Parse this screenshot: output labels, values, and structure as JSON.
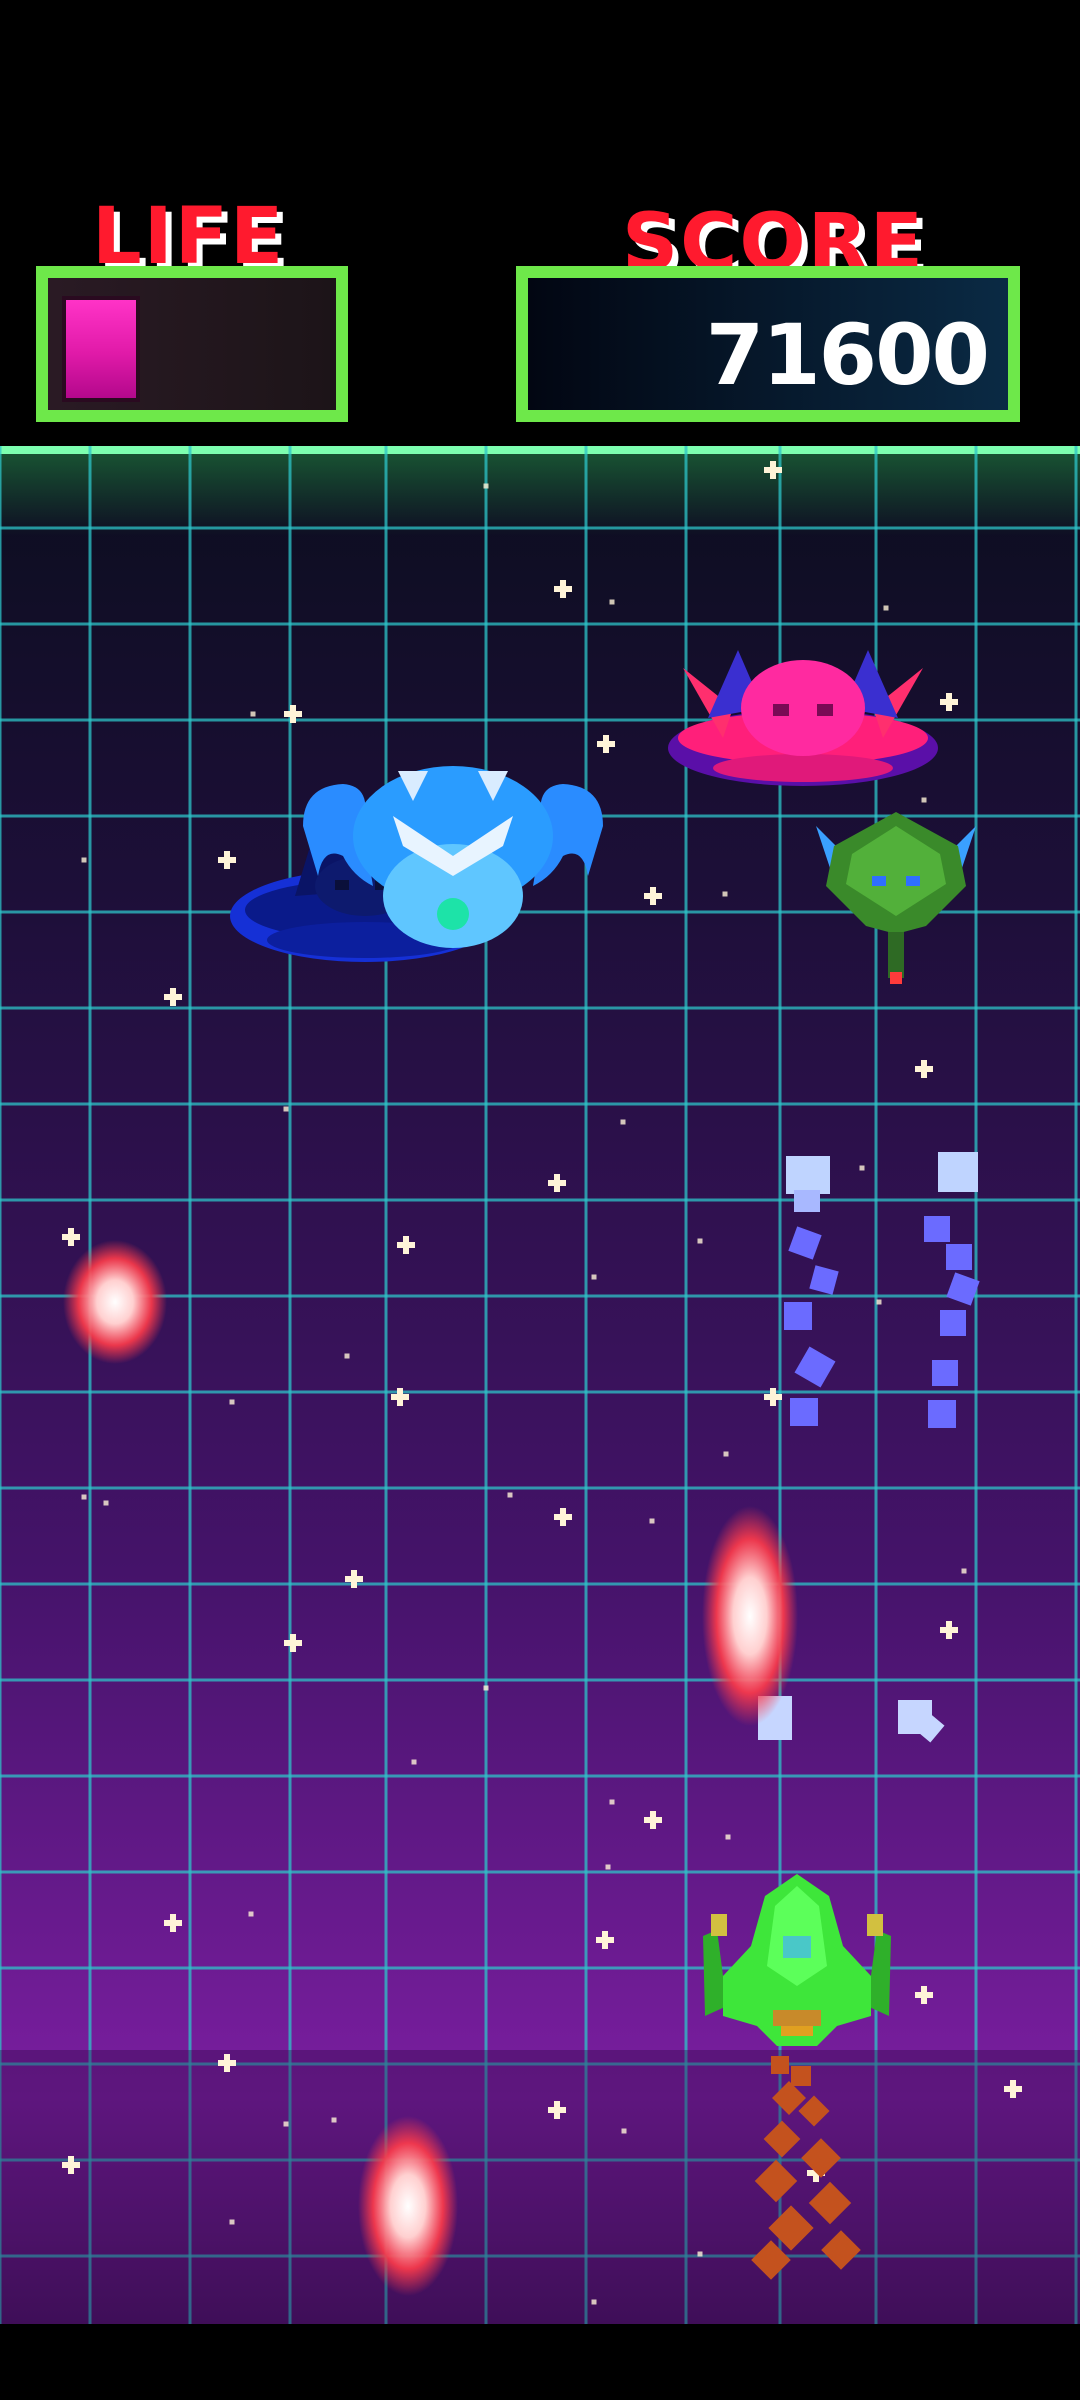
{
  "hud": {
    "life_label": "LIFE",
    "score_label": "SCORE",
    "score_value": "71600",
    "life_fraction": 0.3
  },
  "colors": {
    "hud_border": "#6ee84a",
    "hud_label": "#ff1a2e",
    "grid_line": "#2ec4c8",
    "player_ship": "#3ee63a",
    "life_fill": "#ff33c7"
  },
  "icons": {
    "player": "player-ship-icon",
    "enemy_ufo_blue": "blue-ufo-icon",
    "enemy_ufo_pink": "pink-ufo-icon",
    "enemy_jellyfish": "blue-jellyfish-alien-icon",
    "enemy_green": "green-alien-ship-icon"
  }
}
